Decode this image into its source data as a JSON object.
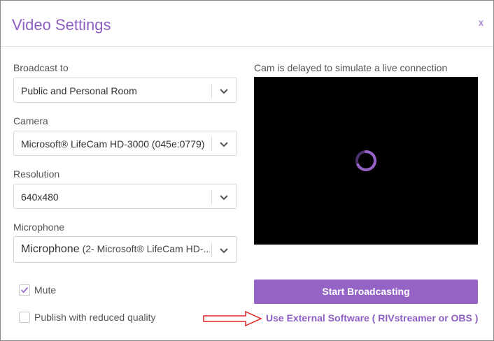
{
  "dialog": {
    "title": "Video Settings",
    "close_label": "x"
  },
  "form": {
    "broadcast": {
      "label": "Broadcast to",
      "value": "Public and Personal Room"
    },
    "camera": {
      "label": "Camera",
      "value": "Microsoft® LifeCam HD-3000 (045e:0779)"
    },
    "resolution": {
      "label": "Resolution",
      "value": "640x480"
    },
    "microphone": {
      "label": "Microphone",
      "value": "Microphone",
      "detail": "(2- Microsoft® LifeCam HD-..."
    }
  },
  "preview": {
    "note": "Cam is delayed to simulate a live connection"
  },
  "options": {
    "mute": {
      "label": "Mute",
      "checked": true
    },
    "reduced_quality": {
      "label": "Publish with reduced quality",
      "checked": false
    }
  },
  "actions": {
    "start_label": "Start Broadcasting",
    "external_label": "Use External Software ( RIVstreamer or OBS )"
  },
  "colors": {
    "accent": "#9563c6",
    "title": "#8e5fc2",
    "arrow": "#e02020",
    "preview_bg": "#000000"
  },
  "icons": {
    "close": "close-icon",
    "dropdown": "chevron-down-icon",
    "checkmark": "checkmark-icon",
    "spinner": "loading-spinner-icon",
    "arrow": "right-arrow-icon"
  }
}
